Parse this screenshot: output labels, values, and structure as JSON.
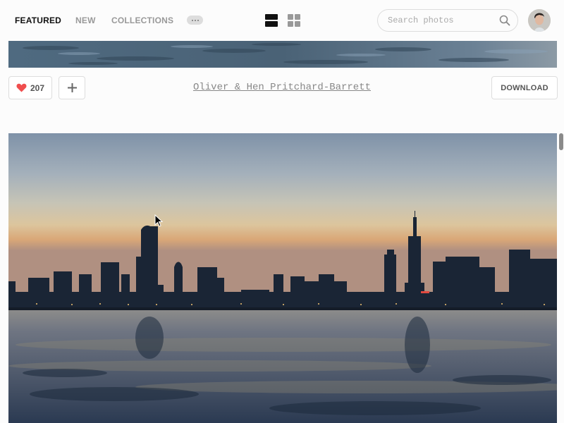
{
  "nav": {
    "links": [
      {
        "label": "FEATURED",
        "active": true
      },
      {
        "label": "NEW",
        "active": false
      },
      {
        "label": "COLLECTIONS",
        "active": false
      }
    ],
    "more_icon": "ellipsis-icon",
    "view_modes": [
      {
        "icon": "list-view-icon",
        "active": true
      },
      {
        "icon": "grid-view-icon",
        "active": false
      }
    ],
    "search": {
      "placeholder": "Search photos",
      "value": "",
      "icon": "search-icon"
    },
    "avatar": "user-avatar"
  },
  "previous_photo": {
    "likes": "207",
    "like_icon": "heart-icon",
    "add_icon": "plus-icon",
    "author": "Oliver & Hen Pritchard-Barrett",
    "download_label": "DOWNLOAD"
  },
  "current_photo": {
    "subject": "city skyline at sunset over water"
  },
  "colors": {
    "accent_heart": "#f04e4e",
    "text_dark": "#111111",
    "text_muted": "#999999"
  }
}
